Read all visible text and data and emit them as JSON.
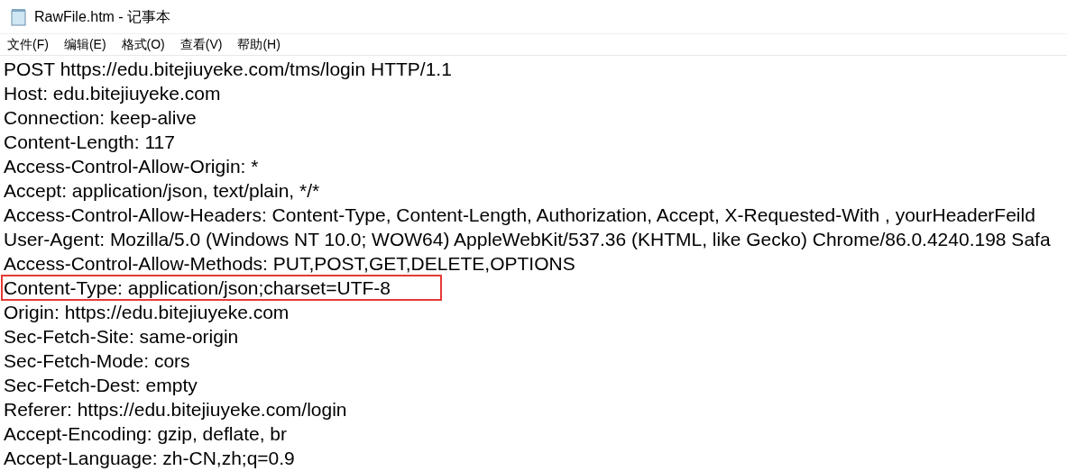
{
  "window": {
    "title": "RawFile.htm - 记事本"
  },
  "menu": [
    "文件(F)",
    "编辑(E)",
    "格式(O)",
    "查看(V)",
    "帮助(H)"
  ],
  "lines": [
    {
      "text": "POST https://edu.bitejiuyeke.com/tms/login HTTP/1.1",
      "highlighted": false
    },
    {
      "text": "Host: edu.bitejiuyeke.com",
      "highlighted": false
    },
    {
      "text": "Connection: keep-alive",
      "highlighted": false
    },
    {
      "text": "Content-Length: 117",
      "highlighted": false
    },
    {
      "text": "Access-Control-Allow-Origin: *",
      "highlighted": false
    },
    {
      "text": "Accept: application/json, text/plain, */*",
      "highlighted": false
    },
    {
      "text": "Access-Control-Allow-Headers: Content-Type, Content-Length, Authorization, Accept, X-Requested-With , yourHeaderFeild",
      "highlighted": false
    },
    {
      "text": "User-Agent: Mozilla/5.0 (Windows NT 10.0; WOW64) AppleWebKit/537.36 (KHTML, like Gecko) Chrome/86.0.4240.198 Safa",
      "highlighted": false
    },
    {
      "text": "Access-Control-Allow-Methods: PUT,POST,GET,DELETE,OPTIONS",
      "highlighted": false
    },
    {
      "text": "Content-Type: application/json;charset=UTF-8",
      "highlighted": true
    },
    {
      "text": "Origin: https://edu.bitejiuyeke.com",
      "highlighted": false
    },
    {
      "text": "Sec-Fetch-Site: same-origin",
      "highlighted": false
    },
    {
      "text": "Sec-Fetch-Mode: cors",
      "highlighted": false
    },
    {
      "text": "Sec-Fetch-Dest: empty",
      "highlighted": false
    },
    {
      "text": "Referer: https://edu.bitejiuyeke.com/login",
      "highlighted": false
    },
    {
      "text": "Accept-Encoding: gzip, deflate, br",
      "highlighted": false
    },
    {
      "text": "Accept-Language: zh-CN,zh;q=0.9",
      "highlighted": false
    }
  ]
}
